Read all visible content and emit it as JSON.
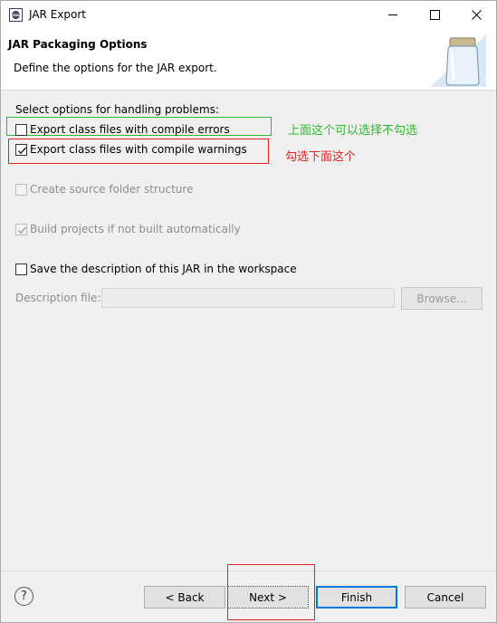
{
  "window": {
    "title": "JAR Export",
    "controls": {
      "minimize": "—",
      "maximize": "☐",
      "close": "✕"
    }
  },
  "header": {
    "title": "JAR Packaging Options",
    "description": "Define the options for the JAR export."
  },
  "options": {
    "section_label": "Select options for handling problems:",
    "export_errors": {
      "label": "Export class files with compile errors",
      "checked": false
    },
    "export_warnings": {
      "label": "Export class files with compile warnings",
      "checked": true
    },
    "create_source_folder": {
      "label": "Create source folder structure",
      "checked": false,
      "enabled": false
    },
    "build_projects": {
      "label": "Build projects if not built automatically",
      "checked": true,
      "enabled": false
    },
    "save_description": {
      "label": "Save the description of this JAR in the workspace",
      "checked": false
    },
    "description_file": {
      "label": "Description file:",
      "value": "",
      "browse_label": "Browse..."
    }
  },
  "annotations": {
    "note_green": "上面这个可以选择不勾选",
    "note_red": "勾选下面这个",
    "green_color": "#2db82d",
    "red_color": "#e02020"
  },
  "footer": {
    "help_label": "?",
    "back_label": "< Back",
    "next_label": "Next >",
    "finish_label": "Finish",
    "cancel_label": "Cancel"
  }
}
